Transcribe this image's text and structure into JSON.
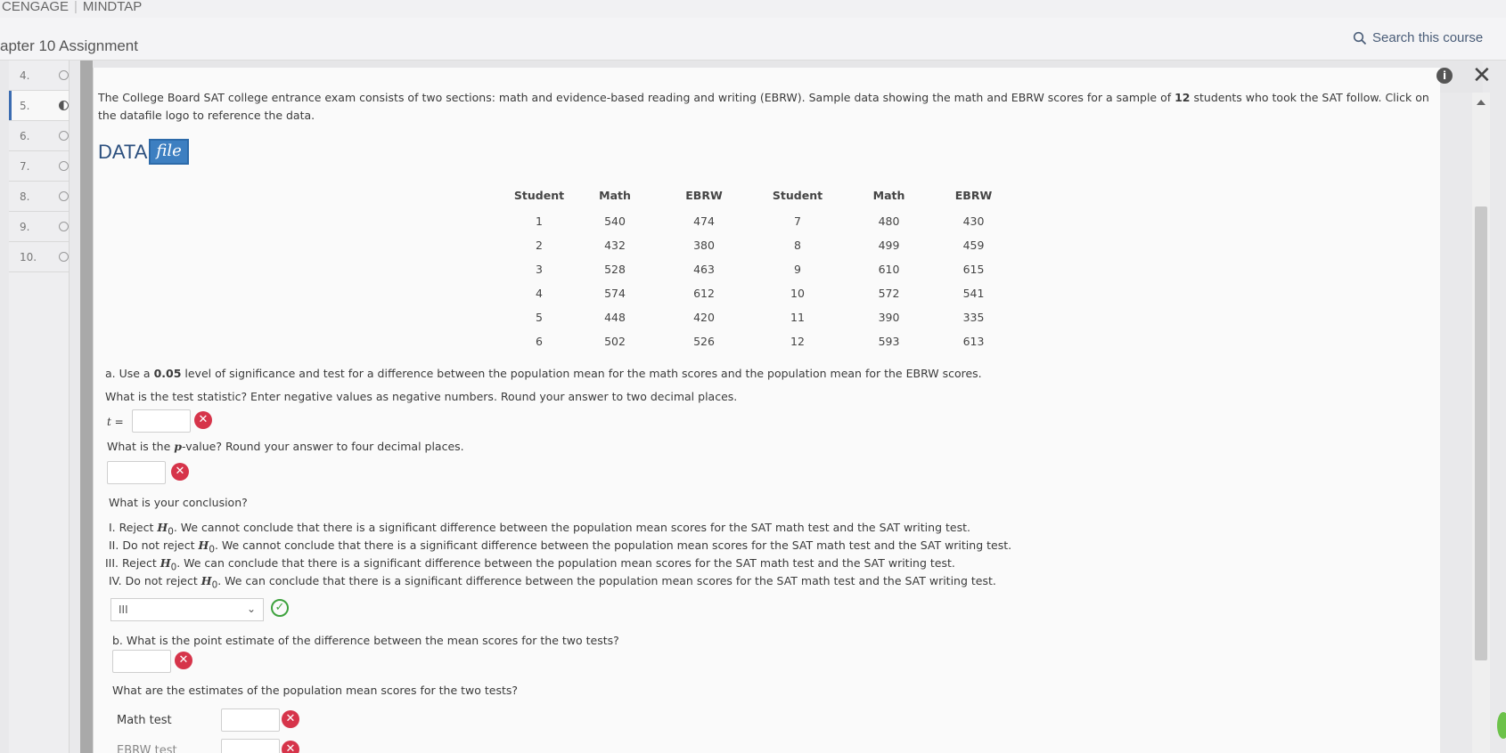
{
  "brand": {
    "left": "CENGAGE",
    "right": "MINDTAP"
  },
  "assignment_title": "apter 10 Assignment",
  "search": {
    "label": "Search this course"
  },
  "nav": [
    {
      "num": "4.",
      "state": "empty"
    },
    {
      "num": "5.",
      "state": "partial",
      "active": true
    },
    {
      "num": "6.",
      "state": "empty"
    },
    {
      "num": "7.",
      "state": "empty"
    },
    {
      "num": "8.",
      "state": "empty"
    },
    {
      "num": "9.",
      "state": "empty"
    },
    {
      "num": "10.",
      "state": "empty"
    }
  ],
  "icons": {
    "info": "info-icon",
    "close": "close-icon",
    "search": "search-icon"
  },
  "intro": {
    "part1": "The College Board SAT college entrance exam consists of two sections: math and evidence-based reading and writing (EBRW). Sample data showing the math and EBRW scores for a sample of ",
    "count": "12",
    "part2": " students who took the SAT follow. Click on the datafile logo to reference the data."
  },
  "datafile": {
    "word": "DATA",
    "file": "file"
  },
  "table": {
    "headers": [
      "Student",
      "Math",
      "EBRW",
      "Student",
      "Math",
      "EBRW"
    ],
    "rows": [
      [
        "1",
        "540",
        "474",
        "7",
        "480",
        "430"
      ],
      [
        "2",
        "432",
        "380",
        "8",
        "499",
        "459"
      ],
      [
        "3",
        "528",
        "463",
        "9",
        "610",
        "615"
      ],
      [
        "4",
        "574",
        "612",
        "10",
        "572",
        "541"
      ],
      [
        "5",
        "448",
        "420",
        "11",
        "390",
        "335"
      ],
      [
        "6",
        "502",
        "526",
        "12",
        "593",
        "613"
      ]
    ]
  },
  "part_a": {
    "prefix": "a. Use a ",
    "alpha": "0.05",
    "suffix": " level of significance and test for a difference between the population mean for the math scores and the population mean for the EBRW scores.",
    "test_stat_q": "What is the test statistic? Enter negative values as negative numbers. Round your answer to two decimal places.",
    "t_label": "t =",
    "t_value": "",
    "pvalue_q_pre": "What is the ",
    "pvalue_p": "p",
    "pvalue_q_post": "-value? Round your answer to four decimal places.",
    "p_value": "",
    "conclusion_q": "What is your conclusion?",
    "options": [
      {
        "num": "I.",
        "pre": " Reject ",
        "h": "H",
        "sub": "0",
        "post": ". We cannot conclude that there is a significant difference between the population mean scores for the SAT math test and the SAT writing test."
      },
      {
        "num": "II.",
        "pre": " Do not reject ",
        "h": "H",
        "sub": "0",
        "post": ". We cannot conclude that there is a significant difference between the population mean scores for the SAT math test and the SAT writing test."
      },
      {
        "num": "III.",
        "pre": " Reject ",
        "h": "H",
        "sub": "0",
        "post": ". We can conclude that there is a significant difference between the population mean scores for the SAT math test and the SAT writing test."
      },
      {
        "num": "IV.",
        "pre": " Do not reject ",
        "h": "H",
        "sub": "0",
        "post": ". We can conclude that there is a significant difference between the population mean scores for the SAT math test and the SAT writing test."
      }
    ],
    "selected": "III"
  },
  "part_b": {
    "q1": "b. What is the point estimate of the difference between the mean scores for the two tests?",
    "point_estimate": "",
    "q2": "What are the estimates of the population mean scores for the two tests?",
    "math_label": "Math test",
    "ebrw_label": "EBRW test"
  },
  "colors": {
    "error": "#d6344a",
    "correct": "#3ea23e",
    "accent": "#3b6cb1"
  }
}
